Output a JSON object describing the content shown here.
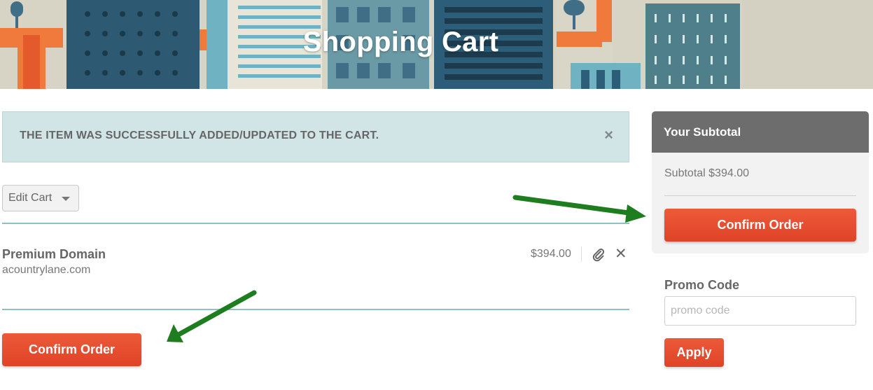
{
  "banner": {
    "title": "Shopping Cart"
  },
  "alert": {
    "message": "THE ITEM WAS SUCCESSFULLY ADDED/UPDATED TO THE CART.",
    "close_icon": "close-icon"
  },
  "cart": {
    "edit_label": "Edit Cart",
    "items": [
      {
        "name": "Premium Domain",
        "domain": "acountrylane.com",
        "price": "$394.00"
      }
    ],
    "confirm_label": "Confirm Order"
  },
  "summary": {
    "header": "Your Subtotal",
    "subtotal": "Subtotal $394.00",
    "confirm_label": "Confirm Order"
  },
  "promo": {
    "label": "Promo Code",
    "placeholder": "promo code",
    "value": "",
    "apply_label": "Apply"
  },
  "colors": {
    "accent": "#e54b2c",
    "alert_bg": "#d1e5e7",
    "divider": "#8cc2c2",
    "summary_header": "#6d6d6d",
    "arrow": "#1e7d1e"
  }
}
